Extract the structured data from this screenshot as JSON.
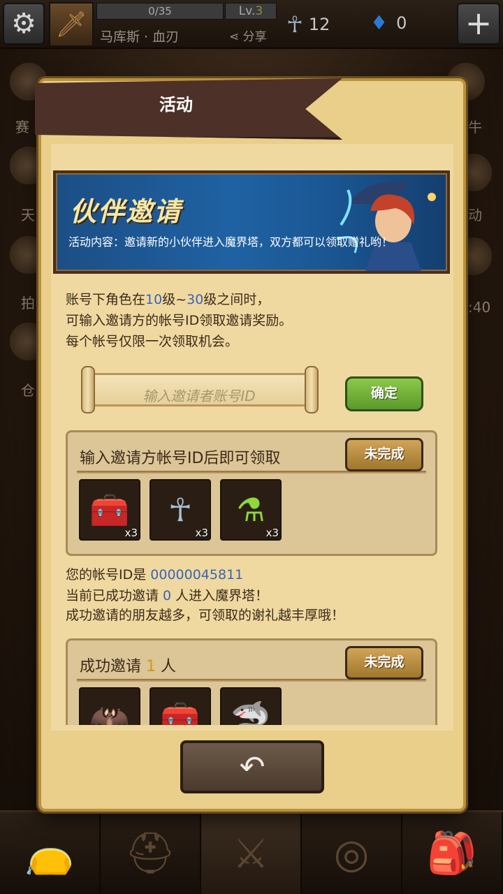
{
  "topbar": {
    "xp": "0/35",
    "level_prefix": "Lv.",
    "level_num": "3",
    "hero_name": "马库斯 · 血刃",
    "share_label": "分享",
    "ankh_count": "12",
    "gem_count": "0"
  },
  "side_labels": {
    "left": [
      "赛",
      "天",
      "拍",
      "仓"
    ],
    "right": [
      "牛",
      "动",
      ":40"
    ]
  },
  "panel": {
    "title": "活动",
    "banner_title": "伙伴邀请",
    "banner_desc": "活动内容：邀请新的小伙伴进入魔界塔，双方都可以领取赠礼哟！",
    "rules": {
      "line1_a": "账号下角色在",
      "line1_b": "10",
      "line1_c": "级~",
      "line1_d": "30",
      "line1_e": "级之间时，",
      "line2": "可输入邀请方的帐号ID领取邀请奖励。",
      "line3": "每个帐号仅限一次领取机会。"
    },
    "input_placeholder": "输入邀请者账号ID",
    "confirm_label": "确定",
    "reward1": {
      "title": "输入邀请方帐号ID后即可领取",
      "status": "未完成",
      "items": [
        {
          "icon": "treasure-chest-icon",
          "count": "x3"
        },
        {
          "icon": "ankh-icon",
          "count": "x3"
        },
        {
          "icon": "green-potion-icon",
          "count": "x3"
        }
      ]
    },
    "info": {
      "line1_a": "您的帐号ID是 ",
      "line1_b": "00000045811",
      "line2_a": "当前已成功邀请 ",
      "line2_b": "0",
      "line2_c": " 人进入魔界塔！",
      "line3": "成功邀请的朋友越多，可领取的谢礼越丰厚哦！"
    },
    "reward2": {
      "title_a": "成功邀请 ",
      "title_b": "1",
      "title_c": " 人",
      "status": "未完成",
      "items": [
        {
          "icon": "purple-bat-icon"
        },
        {
          "icon": "treasure-chest-icon"
        },
        {
          "icon": "shark-pet-icon"
        }
      ]
    },
    "back_icon": "back-arrow-icon"
  },
  "bottom_nav": [
    "treasure-bag-icon",
    "helmet-icon",
    "crossed-swords-icon",
    "target-icon",
    "backpack-icon"
  ],
  "colors": {
    "panel_bg": "#efd9a0",
    "banner_blue": "#1f62a3",
    "highlight_blue": "#3a63b8",
    "confirm_green": "#6cb036",
    "status_gold": "#c0903e"
  }
}
